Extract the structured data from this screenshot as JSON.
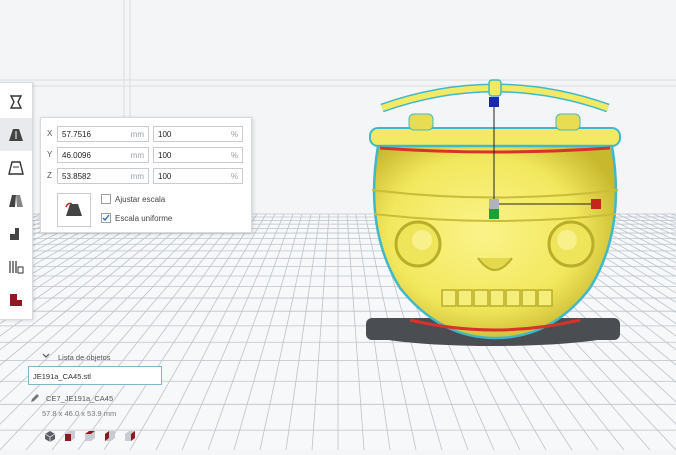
{
  "toolbar": {
    "tools": [
      {
        "name": "move",
        "icon": "move-tool-icon",
        "active": false
      },
      {
        "name": "scale",
        "icon": "scale-tool-icon",
        "active": true
      },
      {
        "name": "rotate",
        "icon": "rotate-tool-icon",
        "active": false
      },
      {
        "name": "mirror",
        "icon": "mirror-tool-icon",
        "active": false
      },
      {
        "name": "per-model-settings",
        "icon": "per-model-settings-icon",
        "active": false
      },
      {
        "name": "support-blocker",
        "icon": "support-blocker-icon",
        "active": false
      },
      {
        "name": "seam",
        "icon": "seam-painting-icon",
        "active": false
      }
    ]
  },
  "scale_panel": {
    "x_label": "X",
    "x_value": "57.7516",
    "x_unit": "mm",
    "x_percent": "100",
    "x_percent_unit": "%",
    "y_label": "Y",
    "y_value": "46.0096",
    "y_unit": "mm",
    "y_percent": "100",
    "y_percent_unit": "%",
    "z_label": "Z",
    "z_value": "53.8582",
    "z_unit": "mm",
    "z_percent": "100",
    "z_percent_unit": "%",
    "snap_scaling_label": "Ajustar escala",
    "snap_scaling_checked": false,
    "uniform_scaling_label": "Escala uniforme",
    "uniform_scaling_checked": true
  },
  "object_list": {
    "header": "Lista de objetos",
    "file_name": "JE191a_CA45.stl",
    "job_name": "CE7_JE191a_CA45",
    "dimensions": "57.8 x 46.0 x 53.9 mm"
  },
  "view_buttons": [
    "3d-view-icon",
    "front-view-icon",
    "top-view-icon",
    "left-view-icon",
    "right-view-icon"
  ],
  "colors": {
    "model": "#f2ea64",
    "model_outline": "#3fb9c9",
    "bed": "#f7f8fa",
    "grid": "#b7bec6",
    "shadow": "#4a4d52",
    "axis_x": "#c3271b",
    "axis_y": "#1d9e3a",
    "axis_z": "#1c2aa8"
  }
}
